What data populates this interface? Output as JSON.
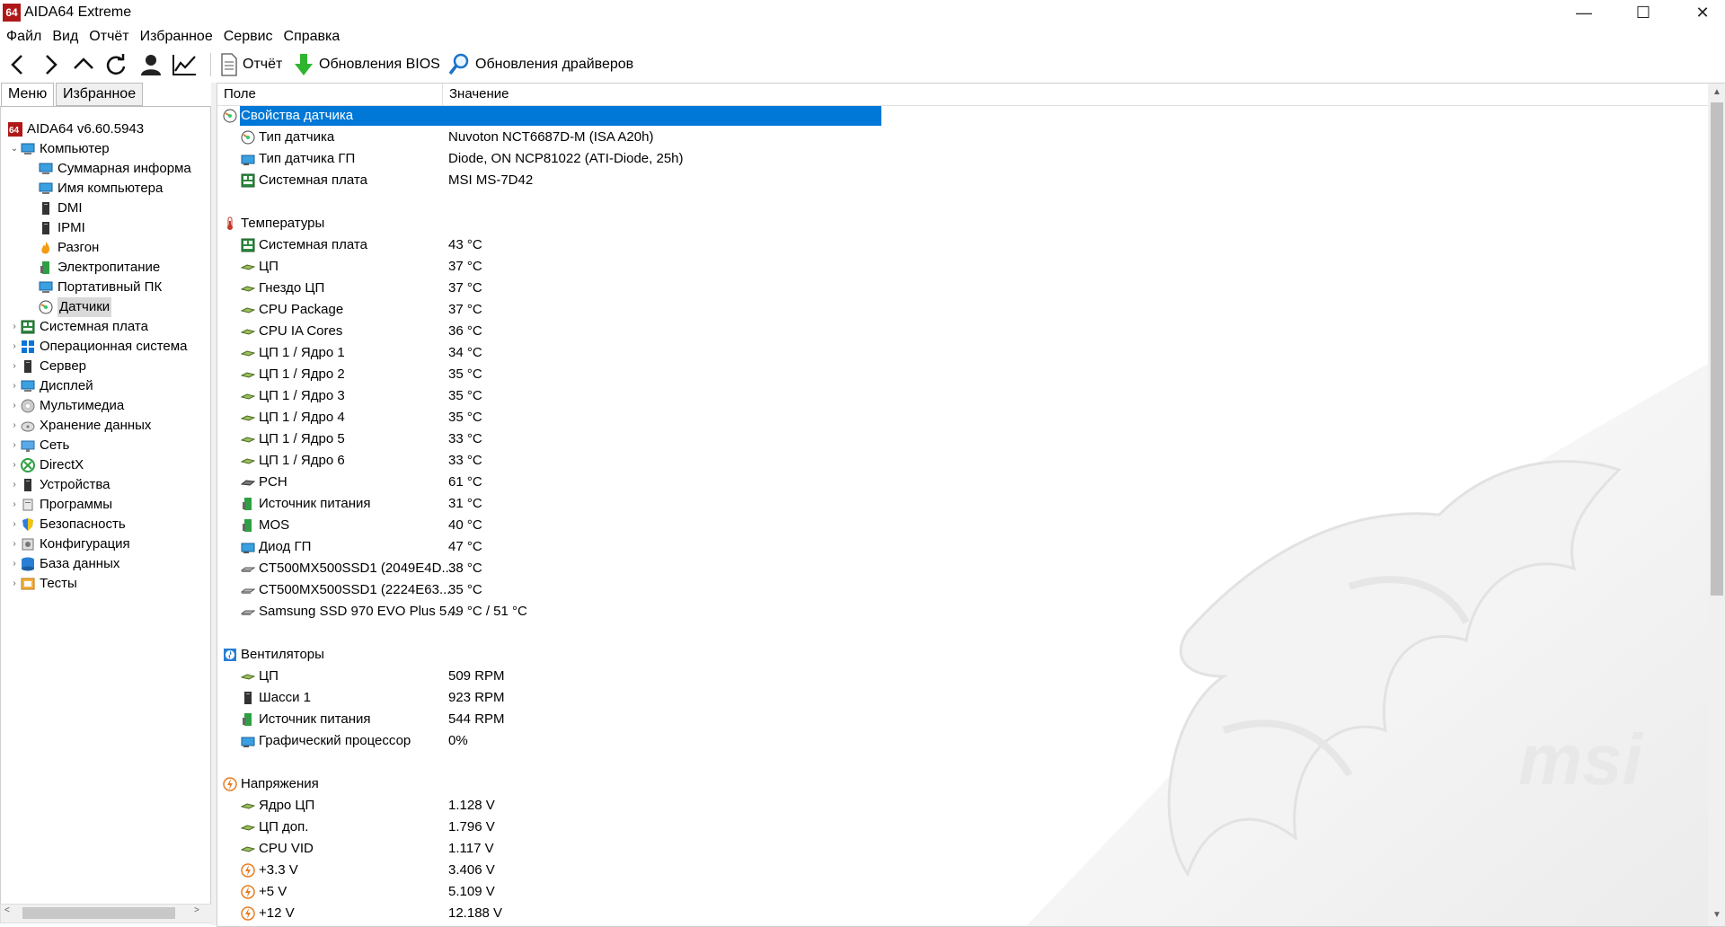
{
  "window": {
    "icon_text": "64",
    "title": "AIDA64 Extreme",
    "controls": {
      "minimize": "—",
      "maximize": "☐",
      "close": "✕"
    }
  },
  "menu": [
    "Файл",
    "Вид",
    "Отчёт",
    "Избранное",
    "Сервис",
    "Справка"
  ],
  "toolbar": {
    "report": "Отчёт",
    "bios_update": "Обновления BIOS",
    "driver_update": "Обновления драйверов"
  },
  "tabs": {
    "menu": "Меню",
    "favorites": "Избранное"
  },
  "tree": [
    {
      "label": "AIDA64 v6.60.5943",
      "icon": "aida64-icon"
    },
    {
      "label": "Компьютер",
      "icon": "computer-icon",
      "expanded": true
    },
    {
      "label": "Суммарная информа",
      "icon": "summary-icon"
    },
    {
      "label": "Имя компьютера",
      "icon": "computer-name-icon"
    },
    {
      "label": "DMI",
      "icon": "dmi-icon"
    },
    {
      "label": "IPMI",
      "icon": "ipmi-icon"
    },
    {
      "label": "Разгон",
      "icon": "overclock-flame-icon"
    },
    {
      "label": "Электропитание",
      "icon": "power-icon"
    },
    {
      "label": "Портативный ПК",
      "icon": "laptop-icon"
    },
    {
      "label": "Датчики",
      "icon": "sensor-icon",
      "selected": true
    },
    {
      "label": "Системная плата",
      "icon": "motherboard-icon"
    },
    {
      "label": "Операционная система",
      "icon": "windows-icon"
    },
    {
      "label": "Сервер",
      "icon": "server-icon"
    },
    {
      "label": "Дисплей",
      "icon": "display-icon"
    },
    {
      "label": "Мультимедиа",
      "icon": "multimedia-icon"
    },
    {
      "label": "Хранение данных",
      "icon": "storage-icon"
    },
    {
      "label": "Сеть",
      "icon": "network-icon"
    },
    {
      "label": "DirectX",
      "icon": "directx-icon"
    },
    {
      "label": "Устройства",
      "icon": "devices-icon"
    },
    {
      "label": "Программы",
      "icon": "programs-icon"
    },
    {
      "label": "Безопасность",
      "icon": "security-shield-icon"
    },
    {
      "label": "Конфигурация",
      "icon": "config-icon"
    },
    {
      "label": "База данных",
      "icon": "database-icon"
    },
    {
      "label": "Тесты",
      "icon": "tests-icon"
    }
  ],
  "columns": {
    "field": "Поле",
    "value": "Значение"
  },
  "sections": [
    {
      "title": "Свойства датчика",
      "icon": "sensor-props-icon",
      "selected": true,
      "rows": [
        {
          "field": "Тип датчика",
          "value": "Nuvoton NCT6687D-M  (ISA A20h)",
          "icon": "sensor-icon"
        },
        {
          "field": "Тип датчика ГП",
          "value": "Diode, ON NCP81022  (ATI-Diode, 25h)",
          "icon": "gpu-icon"
        },
        {
          "field": "Системная плата",
          "value": "MSI MS-7D42",
          "icon": "motherboard-icon"
        }
      ]
    },
    {
      "title": "Температуры",
      "icon": "thermometer-icon",
      "rows": [
        {
          "field": "Системная плата",
          "value": "43 °C",
          "icon": "motherboard-icon"
        },
        {
          "field": "ЦП",
          "value": "37 °C",
          "icon": "cpu-icon"
        },
        {
          "field": "Гнездо ЦП",
          "value": "37 °C",
          "icon": "cpu-icon"
        },
        {
          "field": "CPU Package",
          "value": "37 °C",
          "icon": "cpu-icon"
        },
        {
          "field": "CPU IA Cores",
          "value": "36 °C",
          "icon": "cpu-icon"
        },
        {
          "field": "ЦП 1 / Ядро 1",
          "value": "34 °C",
          "icon": "cpu-icon"
        },
        {
          "field": "ЦП 1 / Ядро 2",
          "value": "35 °C",
          "icon": "cpu-icon"
        },
        {
          "field": "ЦП 1 / Ядро 3",
          "value": "35 °C",
          "icon": "cpu-icon"
        },
        {
          "field": "ЦП 1 / Ядро 4",
          "value": "35 °C",
          "icon": "cpu-icon"
        },
        {
          "field": "ЦП 1 / Ядро 5",
          "value": "33 °C",
          "icon": "cpu-icon"
        },
        {
          "field": "ЦП 1 / Ядро 6",
          "value": "33 °C",
          "icon": "cpu-icon"
        },
        {
          "field": "PCH",
          "value": "61 °C",
          "icon": "chip-icon"
        },
        {
          "field": "Источник питания",
          "value": "31 °C",
          "icon": "power-icon"
        },
        {
          "field": "MOS",
          "value": "40 °C",
          "icon": "power-icon"
        },
        {
          "field": "Диод ГП",
          "value": "47 °C",
          "icon": "gpu-icon"
        },
        {
          "field": "CT500MX500SSD1 (2049E4D...",
          "value": "38 °C",
          "icon": "ssd-icon"
        },
        {
          "field": "CT500MX500SSD1 (2224E63...",
          "value": "35 °C",
          "icon": "ssd-icon"
        },
        {
          "field": "Samsung SSD 970 EVO Plus 5...",
          "value": "49 °C / 51 °C",
          "icon": "ssd-icon"
        }
      ]
    },
    {
      "title": "Вентиляторы",
      "icon": "fan-icon",
      "rows": [
        {
          "field": "ЦП",
          "value": "509 RPM",
          "icon": "cpu-icon"
        },
        {
          "field": "Шасси 1",
          "value": "923 RPM",
          "icon": "chassis-icon"
        },
        {
          "field": "Источник питания",
          "value": "544 RPM",
          "icon": "power-icon"
        },
        {
          "field": "Графический процессор",
          "value": "0%",
          "icon": "gpu-icon"
        }
      ]
    },
    {
      "title": "Напряжения",
      "icon": "voltage-icon",
      "rows": [
        {
          "field": "Ядро ЦП",
          "value": "1.128 V",
          "icon": "cpu-icon"
        },
        {
          "field": "ЦП доп.",
          "value": "1.796 V",
          "icon": "cpu-icon"
        },
        {
          "field": "CPU VID",
          "value": "1.117 V",
          "icon": "cpu-icon"
        },
        {
          "field": "+3.3 V",
          "value": "3.406 V",
          "icon": "voltage-icon"
        },
        {
          "field": "+5 V",
          "value": "5.109 V",
          "icon": "voltage-icon"
        },
        {
          "field": "+12 V",
          "value": "12.188 V",
          "icon": "voltage-icon"
        }
      ]
    }
  ],
  "wallpaper_logo": "msi"
}
